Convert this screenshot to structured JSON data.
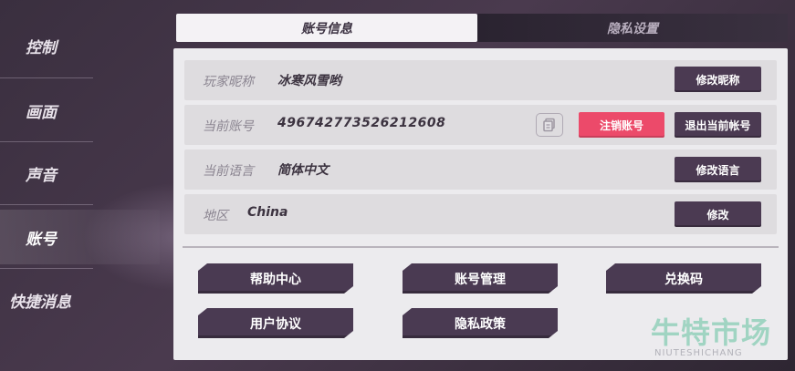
{
  "sidebar": {
    "items": [
      {
        "label": "控制"
      },
      {
        "label": "画面"
      },
      {
        "label": "声音"
      },
      {
        "label": "账号"
      },
      {
        "label": "快捷消息"
      }
    ]
  },
  "tabs": [
    {
      "label": "账号信息"
    },
    {
      "label": "隐私设置"
    }
  ],
  "account": {
    "nickname": {
      "label": "玩家昵称",
      "value": "冰寒风雪哟",
      "button": "修改昵称"
    },
    "account_id": {
      "label": "当前账号",
      "value": "496742773526212608",
      "cancel_button": "注销账号",
      "logout_button": "退出当前帐号"
    },
    "language": {
      "label": "当前语言",
      "value": "简体中文",
      "button": "修改语言"
    },
    "region": {
      "label": "地区",
      "value": "China",
      "button": "修改"
    }
  },
  "actions": {
    "help": "帮助中心",
    "account_manage": "账号管理",
    "redeem": "兑换码",
    "user_agreement": "用户协议",
    "privacy_policy": "隐私政策"
  },
  "watermark": {
    "cn": "牛特市场",
    "en": "NIUTESHICHANG"
  },
  "colors": {
    "accent_red": "#ec4a6a",
    "button_purple": "#4b3a52",
    "panel_bg": "#ecebee"
  }
}
